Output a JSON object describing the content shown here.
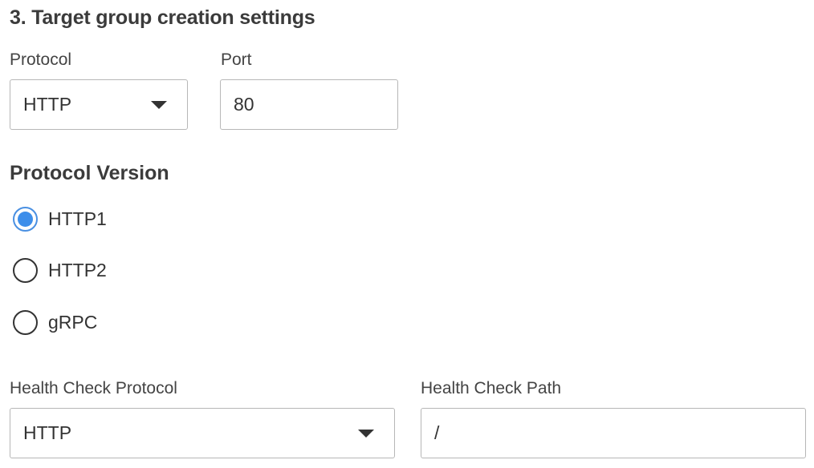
{
  "section": {
    "title": "3. Target group creation settings"
  },
  "protocol": {
    "label": "Protocol",
    "value": "HTTP"
  },
  "port": {
    "label": "Port",
    "value": "80"
  },
  "protocol_version": {
    "title": "Protocol Version",
    "options": [
      {
        "label": "HTTP1",
        "selected": true
      },
      {
        "label": "HTTP2",
        "selected": false
      },
      {
        "label": "gRPC",
        "selected": false
      }
    ]
  },
  "health_check_protocol": {
    "label": "Health Check Protocol",
    "value": "HTTP"
  },
  "health_check_path": {
    "label": "Health Check Path",
    "value": "/"
  },
  "colors": {
    "accent": "#3d8eea",
    "border": "#b7b7b7",
    "text": "#333333"
  },
  "icons": {
    "dropdown": "chevron-down-icon"
  }
}
